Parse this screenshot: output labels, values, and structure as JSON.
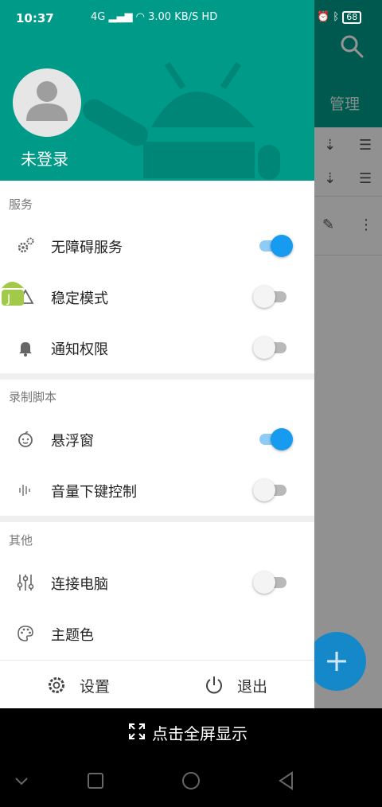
{
  "status_bar": {
    "time": "10:37",
    "network": "4G",
    "speed": "3.00 KB/S",
    "hd": "HD",
    "battery": "68"
  },
  "background_app": {
    "manage_label": "管理",
    "fab_label": "+"
  },
  "drawer": {
    "username": "未登录",
    "sections": [
      {
        "title": "服务",
        "items": [
          {
            "label": "无障碍服务",
            "icon": "gears-icon",
            "toggle": true
          },
          {
            "label": "稳定模式",
            "icon": "triangle-icon",
            "toggle": false
          },
          {
            "label": "通知权限",
            "icon": "bell-icon",
            "toggle": false
          }
        ]
      },
      {
        "title": "录制脚本",
        "items": [
          {
            "label": "悬浮窗",
            "icon": "face-icon",
            "toggle": true
          },
          {
            "label": "音量下键控制",
            "icon": "sound-wave-icon",
            "toggle": false
          }
        ]
      },
      {
        "title": "其他",
        "items": [
          {
            "label": "连接电脑",
            "icon": "sliders-icon",
            "toggle": false
          },
          {
            "label": "主题色",
            "icon": "palette-icon",
            "toggle": null
          }
        ]
      }
    ],
    "footer": {
      "settings_label": "设置",
      "logout_label": "退出"
    }
  },
  "fullscreen_bar": {
    "label": "点击全屏显示"
  },
  "colors": {
    "accent": "#009a88",
    "switch_on": "#169bf0"
  }
}
